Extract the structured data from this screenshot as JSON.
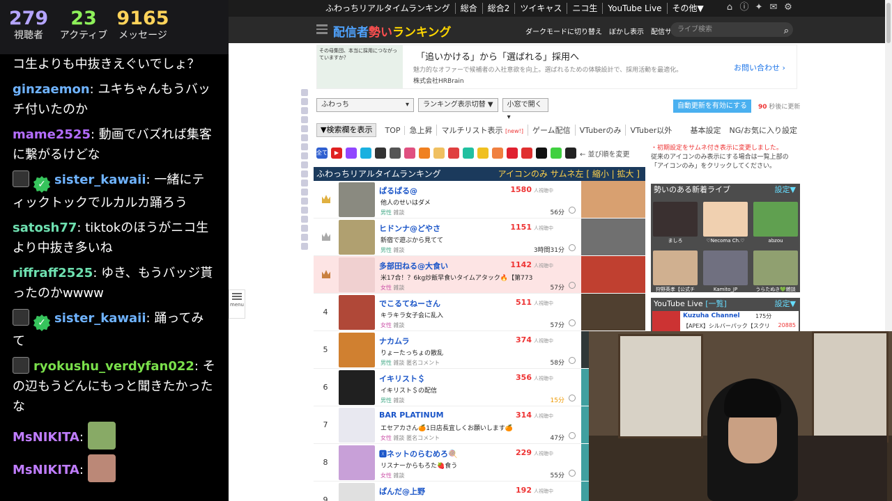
{
  "chat": {
    "stats": [
      {
        "value": "279",
        "label": "視聴者"
      },
      {
        "value": "23",
        "label": "アクティブ"
      },
      {
        "value": "9165",
        "label": "メッセージ"
      }
    ],
    "messages": [
      {
        "user": "",
        "color": "#ffffff",
        "text": "コ生よりも中抜きえぐいでしょ？",
        "badges": []
      },
      {
        "user": "ginzaemon",
        "color": "#6fb3ff",
        "text": "ユキちゃんもうバッチ付いたのか",
        "badges": []
      },
      {
        "user": "mame2525",
        "color": "#b46dff",
        "text": "動画でバズれば集客に繋がるけどな",
        "badges": []
      },
      {
        "user": "sister_kawaii",
        "color": "#6fb3ff",
        "text": "一緒にティックトックでルカルカ踊ろう",
        "badges": [
          "cat",
          "check"
        ]
      },
      {
        "user": "satosh77",
        "color": "#6ee0b0",
        "text": "tiktokのほうがニコ生より中抜き多いね",
        "badges": []
      },
      {
        "user": "riffraff2525",
        "color": "#6ee0b0",
        "text": "ゆき、もうバッジ貰ったのかwwww",
        "badges": []
      },
      {
        "user": "sister_kawaii",
        "color": "#6fb3ff",
        "text": "踊ってみて",
        "badges": [
          "cat",
          "check"
        ]
      },
      {
        "user": "ryokushu_verdyfan022",
        "color": "#7ae04b",
        "text": "その辺もうどんにもっと聞きたかったな",
        "badges": [
          "cat"
        ]
      },
      {
        "user": "MsNIKITA",
        "color": "#c07dff",
        "text": "",
        "badges": [],
        "emote": "e1"
      },
      {
        "user": "MsNIKITA",
        "color": "#c07dff",
        "text": "",
        "badges": [],
        "emote": "e2"
      }
    ]
  },
  "site": {
    "topnav": [
      "ふわっちリアルタイムランキング",
      "総合",
      "総合2",
      "ツイキャス",
      "ニコ生",
      "YouTube Live",
      "その他▼"
    ],
    "topicons": [
      "home-icon",
      "info-icon",
      "twitter-icon",
      "mail-icon",
      "gear-icon"
    ],
    "logo": {
      "a": "配信者",
      "b": "勢い",
      "c": "ランキング"
    },
    "header_links": [
      "ダークモードに切り替え",
      "ぼかし表示",
      "配信サイト▼"
    ],
    "search_placeholder": "ライブ検索",
    "ad": {
      "img_text": "その母集団、本当に採用につながっていますか？",
      "title": "「追いかける」から「選ばれる」採用へ",
      "sub": "魅力的なオファーで候補者の入社意欲を向上。選ばれるための体験設計で、採用活動を最適化。",
      "company": "株式会社HRBrain",
      "cta": "お問い合わせ"
    },
    "controls": {
      "site_select": "ふわっち",
      "view_toggle": "ランキング表示切替 ▼",
      "window_select": "小窓で開く",
      "auto_btn": "自動更新を有効にする",
      "refresh_sec": "90",
      "refresh_text": "秒後に更新"
    },
    "tabs": {
      "search_btn": "▼検索欄を表示",
      "items": [
        "TOP",
        "急上昇",
        "マルチリスト表示",
        "ゲーム配信",
        "VTuberのみ",
        "VTuber以外"
      ],
      "new_label": "[new!]",
      "right": [
        "基本設定",
        "NG/お気に入り設定"
      ]
    },
    "filter": {
      "all": "全て",
      "sort_text": "← 並び順を変更"
    },
    "notice": {
      "line1": "・初期設定をサムネ付き表示に変更しました。",
      "line2": "従来のアイコンのみ表示にする場合は一覧上部の「アイコンのみ」をクリックしてください。"
    },
    "ranking": {
      "title": "ふわっちリアルタイムランキング",
      "opts": "アイコンのみ  サムネ左 [ 縮小 | 拡大 ]",
      "viewers_label": "人視聴中",
      "rows": [
        {
          "rank": "",
          "crown": "gold",
          "name": "ぱるぱる@",
          "title": "他人のせいはダメ",
          "tags": [
            "男性",
            "雑談"
          ],
          "count": "1580",
          "time": "56分",
          "avatar": "#8a8a80",
          "thumb": "#d8a070",
          "pink": false
        },
        {
          "rank": "",
          "crown": "silver",
          "name": "ヒドンナ@どやさ",
          "title": "新宿で遊ぶから見てて",
          "tags": [
            "男性",
            "雑談"
          ],
          "count": "1151",
          "time": "3時間31分",
          "avatar": "#b0a070",
          "thumb": "#707070",
          "pink": false
        },
        {
          "rank": "",
          "crown": "bronze",
          "name": "多部田ねる@大食い",
          "title": "米17合！？6kg炒飯早食いタイムアタック🔥【第773",
          "tags": [
            "女性",
            "雑談"
          ],
          "count": "1142",
          "time": "57分",
          "avatar": "#f0d0d0",
          "thumb": "#c04030",
          "pink": true
        },
        {
          "rank": "4",
          "crown": "",
          "name": "でこるてねーさん",
          "title": "キラキラ女子会に乱入",
          "tags": [
            "女性",
            "雑談"
          ],
          "count": "511",
          "time": "57分",
          "avatar": "#b04838",
          "thumb": "#504030",
          "pink": false
        },
        {
          "rank": "5",
          "crown": "",
          "name": "ナカムラ",
          "title": "りょーたっちょの散乱",
          "tags": [
            "男性",
            "雑談",
            "匿名コメント"
          ],
          "count": "374",
          "time": "58分",
          "avatar": "#d08030",
          "thumb": "#303838",
          "pink": false
        },
        {
          "rank": "6",
          "crown": "",
          "name": "イキリスト＄",
          "title": "イキリスト＄の配信",
          "tags": [
            "男性",
            "雑談"
          ],
          "count": "356",
          "time": "15分",
          "avatar": "#202020",
          "thumb": "#40a0a0",
          "pink": false,
          "warn": true
        },
        {
          "rank": "7",
          "crown": "",
          "name": "BAR PLATINUM",
          "title": "エセアカさん🍊1日店長宜しくお願いします🍊",
          "tags": [
            "女性",
            "雑談",
            "匿名コメント"
          ],
          "count": "314",
          "time": "47分",
          "avatar": "#e8e8f0",
          "thumb": "#40a0a0",
          "pink": false
        },
        {
          "rank": "8",
          "crown": "",
          "name": "🆇ネットのらむめろ🍭",
          "title": "リスナーからもろた🍓食う",
          "tags": [
            "女性",
            "雑談"
          ],
          "count": "229",
          "time": "55分",
          "avatar": "#c8a0d8",
          "thumb": "#40a0a0",
          "pink": false
        },
        {
          "rank": "9",
          "crown": "",
          "name": "ぱんだ@上野",
          "title": "",
          "tags": [],
          "count": "192",
          "time": "",
          "avatar": "#e0e0e0",
          "thumb": "#40a0a0",
          "pink": false
        }
      ]
    },
    "new_lives": {
      "title": "勢いのある新着ライブ",
      "settings": "設定▼",
      "items": [
        {
          "name": "ましろ",
          "color": "#3a3030"
        },
        {
          "name": "♡Necoma Ch.♡",
          "color": "#f0d0b0"
        },
        {
          "name": "abzou",
          "color": "#60a050"
        },
        {
          "name": "狩野英孝【公式チ",
          "color": "#d0b090"
        },
        {
          "name": "Kamito_JP",
          "color": "#707080"
        },
        {
          "name": "うらたぬき💚雑談",
          "color": "#90a070"
        }
      ]
    },
    "youtube": {
      "title": "YouTube Live",
      "list": "[一覧]",
      "settings": "設定▼",
      "row": {
        "name": "Kuzuha Channel",
        "minutes": "175分",
        "title": "【APEX】シルバーパック【スクリ",
        "count": "20885"
      }
    },
    "menu_label": "menu"
  }
}
